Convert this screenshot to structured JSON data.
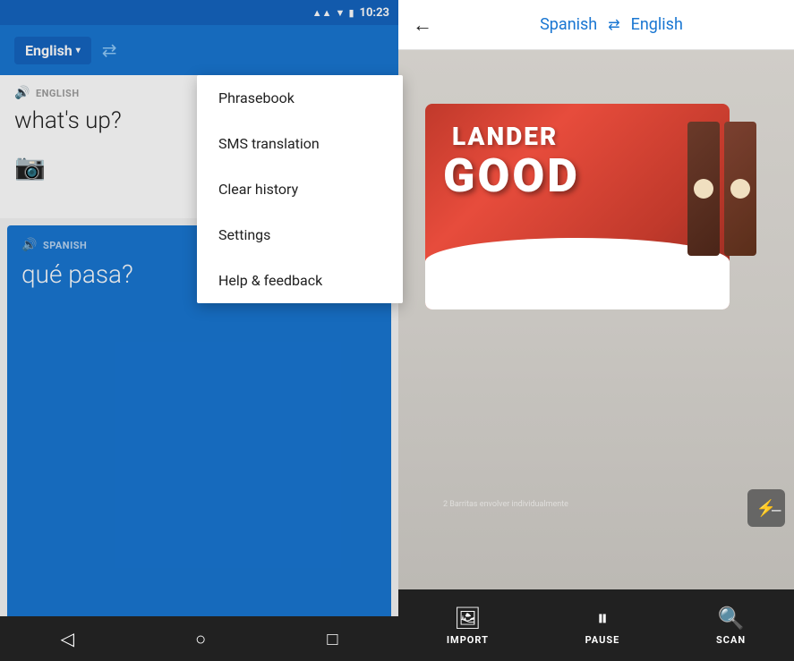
{
  "status": {
    "time": "10:23"
  },
  "left_panel": {
    "source_lang": "English",
    "source_lang_arrow": "▾",
    "swap_icon": "⇄",
    "source_label": "ENGLISH",
    "source_text": "what's up?",
    "translation_label": "SPANISH",
    "translation_text": "qué pasa?",
    "star_label": "☆",
    "copy_label": "⧉",
    "more_label": "⋮"
  },
  "menu": {
    "items": [
      {
        "label": "Phrasebook"
      },
      {
        "label": "SMS translation"
      },
      {
        "label": "Clear history"
      },
      {
        "label": "Settings"
      },
      {
        "label": "Help & feedback"
      }
    ]
  },
  "nav": {
    "back": "◁",
    "home": "○",
    "recent": "□"
  },
  "right_panel": {
    "back_icon": "←",
    "source_lang": "Spanish",
    "swap_icon": "⇄",
    "target_lang": "English",
    "flash_off_icon": "⚡",
    "bottom_actions": [
      {
        "icon": "🖼",
        "label": "IMPORT"
      },
      {
        "icon": "⏸",
        "label": "PAUSE"
      },
      {
        "icon": "🔍",
        "label": "SCAN"
      }
    ]
  },
  "chocolate": {
    "brand": "LANDER",
    "name": "GOOD"
  }
}
